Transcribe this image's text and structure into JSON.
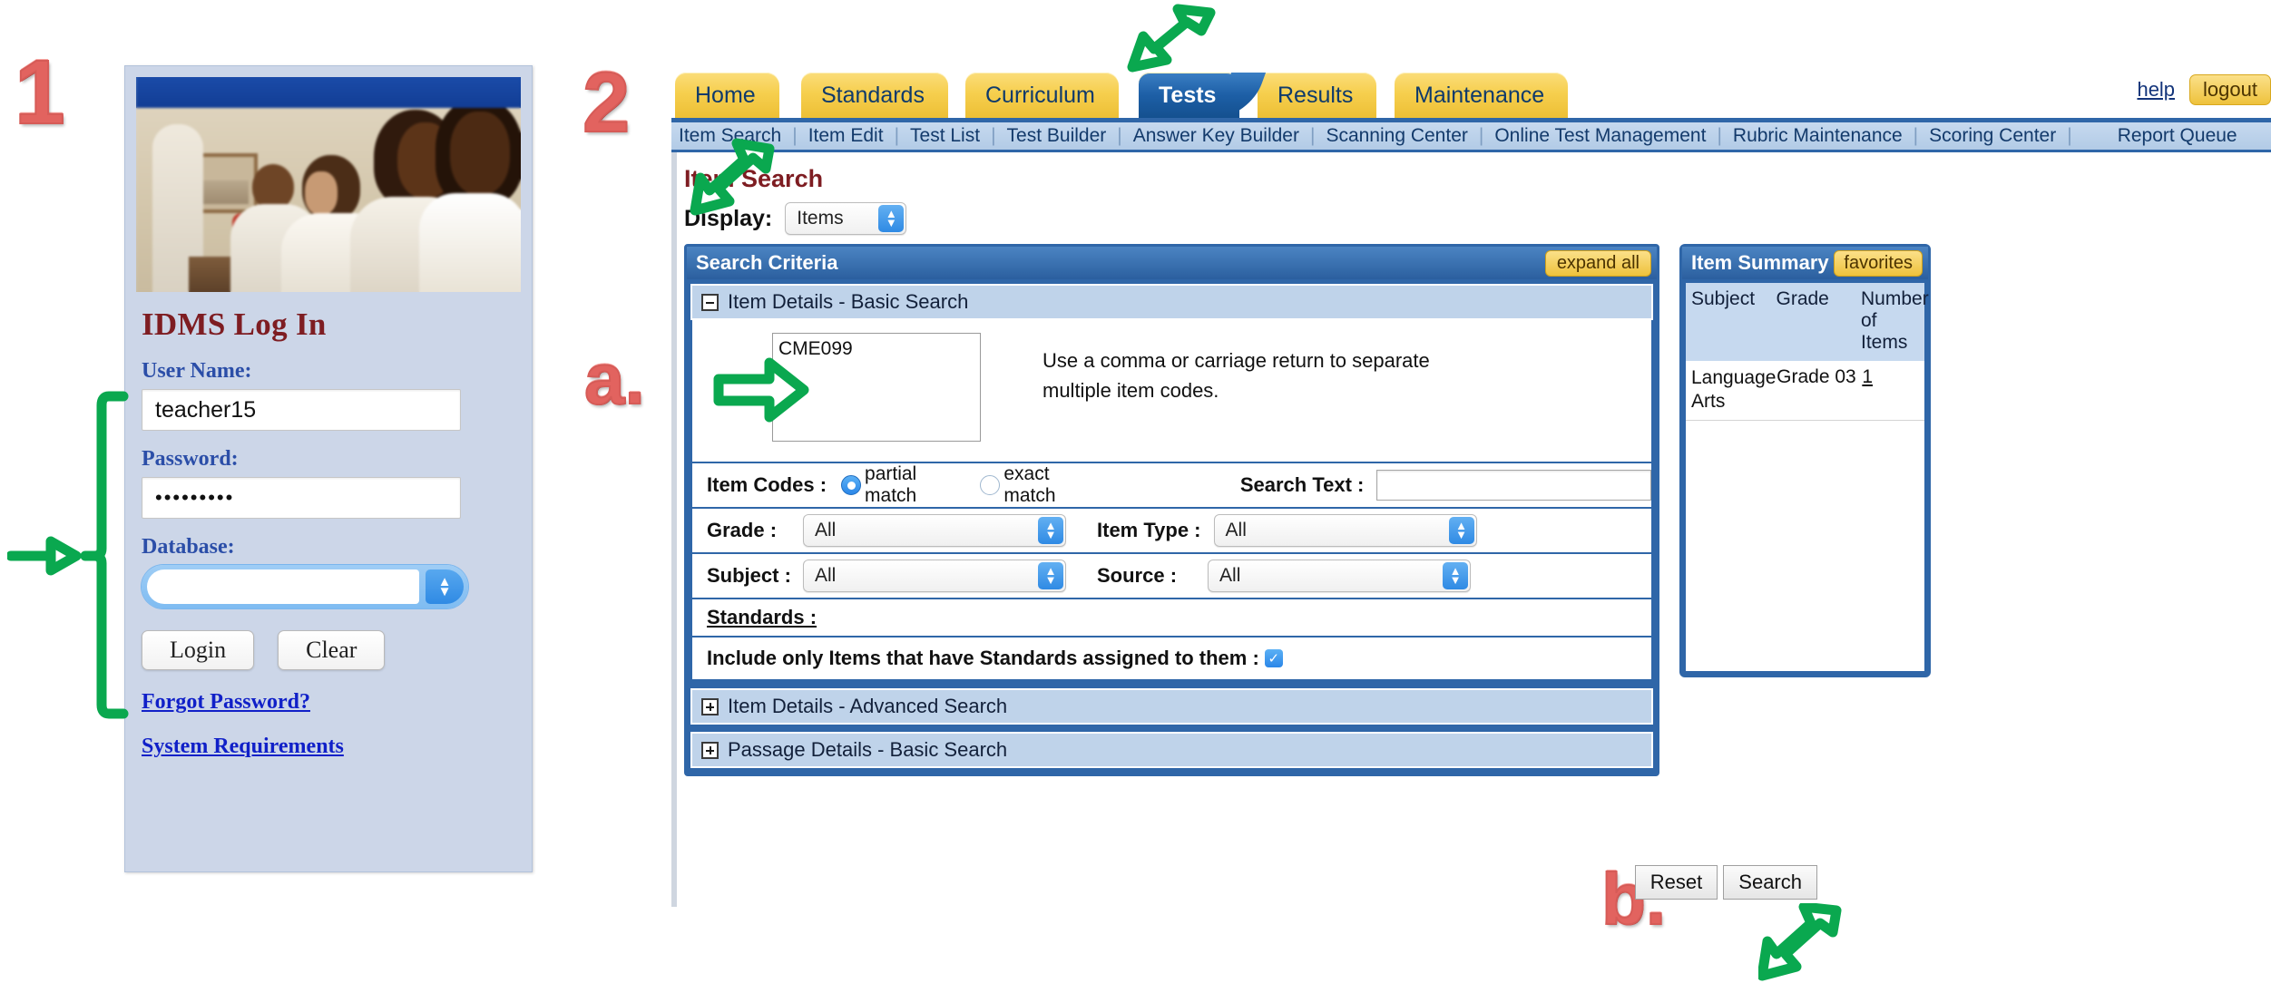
{
  "annotations": {
    "marker_1": "1",
    "marker_2": "2",
    "marker_a": "a.",
    "marker_b": "b."
  },
  "login": {
    "title": "IDMS Log In",
    "username_label": "User Name:",
    "username_value": "teacher15",
    "username_placeholder": "",
    "password_label": "Password:",
    "password_value": "•••••••••",
    "password_placeholder": "",
    "database_label": "Database:",
    "database_value": "",
    "login_button": "Login",
    "clear_button": "Clear",
    "forgot_password_link": "Forgot Password?",
    "system_requirements_link": "System Requirements"
  },
  "app": {
    "tabs": [
      {
        "label": "Home",
        "active": false
      },
      {
        "label": "Standards",
        "active": false
      },
      {
        "label": "Curriculum",
        "active": false
      },
      {
        "label": "Tests",
        "active": true
      },
      {
        "label": "Results",
        "active": false
      },
      {
        "label": "Maintenance",
        "active": false
      }
    ],
    "help_link": "help",
    "logout_button": "logout",
    "subnav": [
      "Item Search",
      "Item Edit",
      "Test List",
      "Test Builder",
      "Answer Key Builder",
      "Scanning Center",
      "Online Test Management",
      "Rubric Maintenance",
      "Scoring Center"
    ],
    "subnav_far": "Report Queue",
    "page_title": "Item Search",
    "display_label": "Display:",
    "display_value": "Items"
  },
  "criteria": {
    "header_title": "Search Criteria",
    "expand_all_button": "expand all",
    "section_basic": "Item Details - Basic Search",
    "section_advanced": "Item Details - Advanced Search",
    "section_passage": "Passage Details - Basic Search",
    "item_codes_value": "CME099",
    "item_codes_hint": "Use a comma or carriage return to separate multiple item codes.",
    "item_codes_label": "Item Codes :",
    "radio_partial": "partial match",
    "radio_exact": "exact match",
    "radio_selected": "partial match",
    "search_text_label": "Search Text :",
    "search_text_value": "",
    "grade_label": "Grade :",
    "grade_value": "All",
    "item_type_label": "Item Type :",
    "item_type_value": "All",
    "subject_label": "Subject :",
    "subject_value": "All",
    "source_label": "Source :",
    "source_value": "All",
    "standards_label": "Standards :",
    "include_standards_label": "Include only Items that have Standards assigned to them :",
    "include_standards_checked": "✓"
  },
  "summary": {
    "header_title": "Item Summary",
    "favorites_button": "favorites",
    "columns": [
      "Subject",
      "Grade",
      "Number of Items"
    ],
    "col_number_line1": "Number",
    "col_number_line2": "of Items",
    "rows": [
      {
        "subject": "Language Arts",
        "grade": "Grade 03",
        "count": "1"
      }
    ]
  },
  "footer": {
    "reset_button": "Reset",
    "search_button": "Search"
  },
  "colors": {
    "accent_blue": "#2f66a8",
    "tab_yellow": "#f6cf4e",
    "annotation_red": "#e2635f",
    "annotation_green": "#0aa84f",
    "title_maroon": "#7e1d22"
  }
}
